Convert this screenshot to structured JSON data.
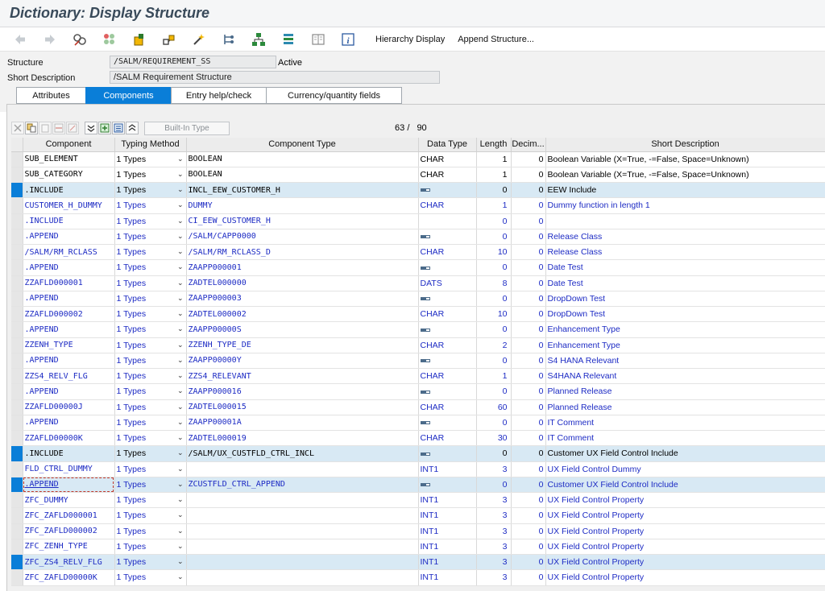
{
  "window": {
    "title": "Dictionary: Display Structure"
  },
  "toolbar": {
    "icons": [
      "back-icon",
      "forward-icon",
      "other-object-icon",
      "display-change-icon",
      "activate-icon",
      "where-used-icon",
      "test-icon",
      "object-list-icon",
      "hierarchy-icon",
      "stack-icon",
      "documentation-icon",
      "info-icon"
    ],
    "hierarchy_display": "Hierarchy Display",
    "append_structure": "Append Structure..."
  },
  "header": {
    "structure_label": "Structure",
    "structure_value": "/SALM/REQUIREMENT_SS",
    "status": "Active",
    "short_desc_label": "Short Description",
    "short_desc_value": "/SALM Requirement Structure"
  },
  "tabs": [
    {
      "label": "Attributes"
    },
    {
      "label": "Components"
    },
    {
      "label": "Entry help/check"
    },
    {
      "label": "Currency/quantity fields"
    }
  ],
  "grid_toolbar": {
    "builtin_type": "Built-In Type"
  },
  "counter": {
    "current": "63",
    "sep": "/",
    "total": "90"
  },
  "columns": [
    "Component",
    "Typing Method",
    "Component Type",
    "Data Type",
    "Length",
    "Decim...",
    "Short Description"
  ],
  "rows": [
    {
      "comp": "SUB_ELEMENT",
      "typing": "1 Types",
      "ctype": "BOOLEAN",
      "dtype": "CHAR",
      "len": "1",
      "dec": "0",
      "desc": "Boolean Variable (X=True, -=False, Space=Unknown)",
      "style": "norm",
      "blue": false,
      "ref": false,
      "mark": false
    },
    {
      "comp": "SUB_CATEGORY",
      "typing": "1 Types",
      "ctype": "BOOLEAN",
      "dtype": "CHAR",
      "len": "1",
      "dec": "0",
      "desc": "Boolean Variable (X=True, -=False, Space=Unknown)",
      "style": "norm",
      "blue": false,
      "ref": false,
      "mark": false
    },
    {
      "comp": ".INCLUDE",
      "typing": "1 Types",
      "ctype": "INCL_EEW_CUSTOMER_H",
      "dtype": "",
      "len": "0",
      "dec": "0",
      "desc": "EEW Include",
      "style": "hl",
      "blue": false,
      "ref": true,
      "mark": true
    },
    {
      "comp": "CUSTOMER_H_DUMMY",
      "typing": "1 Types",
      "ctype": "DUMMY",
      "dtype": "CHAR",
      "len": "1",
      "dec": "0",
      "desc": "Dummy function in length 1",
      "style": "norm",
      "blue": true,
      "ref": false,
      "mark": false
    },
    {
      "comp": ".INCLUDE",
      "typing": "1 Types",
      "ctype": "CI_EEW_CUSTOMER_H",
      "dtype": "",
      "len": "0",
      "dec": "0",
      "desc": "",
      "style": "norm",
      "blue": true,
      "ref": false,
      "mark": false
    },
    {
      "comp": ".APPEND",
      "typing": "1 Types",
      "ctype": "/SALM/CAPP0000",
      "dtype": "",
      "len": "0",
      "dec": "0",
      "desc": "Release Class",
      "style": "norm",
      "blue": true,
      "ref": true,
      "mark": false
    },
    {
      "comp": "/SALM/RM_RCLASS",
      "typing": "1 Types",
      "ctype": "/SALM/RM_RCLASS_D",
      "dtype": "CHAR",
      "len": "10",
      "dec": "0",
      "desc": "Release Class",
      "style": "norm",
      "blue": true,
      "ref": false,
      "mark": false
    },
    {
      "comp": ".APPEND",
      "typing": "1 Types",
      "ctype": "ZAAPP000001",
      "dtype": "",
      "len": "0",
      "dec": "0",
      "desc": "Date Test",
      "style": "norm",
      "blue": true,
      "ref": true,
      "mark": false
    },
    {
      "comp": "ZZAFLD000001",
      "typing": "1 Types",
      "ctype": "ZADTEL000000",
      "dtype": "DATS",
      "len": "8",
      "dec": "0",
      "desc": "Date Test",
      "style": "norm",
      "blue": true,
      "ref": false,
      "mark": false
    },
    {
      "comp": ".APPEND",
      "typing": "1 Types",
      "ctype": "ZAAPP000003",
      "dtype": "",
      "len": "0",
      "dec": "0",
      "desc": "DropDown Test",
      "style": "norm",
      "blue": true,
      "ref": true,
      "mark": false
    },
    {
      "comp": "ZZAFLD000002",
      "typing": "1 Types",
      "ctype": "ZADTEL000002",
      "dtype": "CHAR",
      "len": "10",
      "dec": "0",
      "desc": "DropDown Test",
      "style": "norm",
      "blue": true,
      "ref": false,
      "mark": false
    },
    {
      "comp": ".APPEND",
      "typing": "1 Types",
      "ctype": "ZAAPP00000S",
      "dtype": "",
      "len": "0",
      "dec": "0",
      "desc": "Enhancement Type",
      "style": "norm",
      "blue": true,
      "ref": true,
      "mark": false
    },
    {
      "comp": "ZZENH_TYPE",
      "typing": "1 Types",
      "ctype": "ZZENH_TYPE_DE",
      "dtype": "CHAR",
      "len": "2",
      "dec": "0",
      "desc": "Enhancement Type",
      "style": "norm",
      "blue": true,
      "ref": false,
      "mark": false
    },
    {
      "comp": ".APPEND",
      "typing": "1 Types",
      "ctype": "ZAAPP00000Y",
      "dtype": "",
      "len": "0",
      "dec": "0",
      "desc": "S4 HANA Relevant",
      "style": "norm",
      "blue": true,
      "ref": true,
      "mark": false
    },
    {
      "comp": "ZZS4_RELV_FLG",
      "typing": "1 Types",
      "ctype": "ZZS4_RELEVANT",
      "dtype": "CHAR",
      "len": "1",
      "dec": "0",
      "desc": "S4HANA Relevant",
      "style": "norm",
      "blue": true,
      "ref": false,
      "mark": false
    },
    {
      "comp": ".APPEND",
      "typing": "1 Types",
      "ctype": "ZAAPP000016",
      "dtype": "",
      "len": "0",
      "dec": "0",
      "desc": "Planned Release",
      "style": "norm",
      "blue": true,
      "ref": true,
      "mark": false
    },
    {
      "comp": "ZZAFLD00000J",
      "typing": "1 Types",
      "ctype": "ZADTEL000015",
      "dtype": "CHAR",
      "len": "60",
      "dec": "0",
      "desc": "Planned Release",
      "style": "norm",
      "blue": true,
      "ref": false,
      "mark": false
    },
    {
      "comp": ".APPEND",
      "typing": "1 Types",
      "ctype": "ZAAPP00001A",
      "dtype": "",
      "len": "0",
      "dec": "0",
      "desc": "IT Comment",
      "style": "norm",
      "blue": true,
      "ref": true,
      "mark": false
    },
    {
      "comp": "ZZAFLD00000K",
      "typing": "1 Types",
      "ctype": "ZADTEL000019",
      "dtype": "CHAR",
      "len": "30",
      "dec": "0",
      "desc": "IT Comment",
      "style": "norm",
      "blue": true,
      "ref": false,
      "mark": false
    },
    {
      "comp": ".INCLUDE",
      "typing": "1 Types",
      "ctype": "/SALM/UX_CUSTFLD_CTRL_INCL",
      "dtype": "",
      "len": "0",
      "dec": "0",
      "desc": "Customer UX Field Control Include",
      "style": "hl",
      "blue": false,
      "ref": true,
      "mark": true
    },
    {
      "comp": "FLD_CTRL_DUMMY",
      "typing": "1 Types",
      "ctype": "",
      "dtype": "INT1",
      "len": "3",
      "dec": "0",
      "desc": "UX Field Control Dummy",
      "style": "norm",
      "blue": true,
      "ref": false,
      "mark": false
    },
    {
      "comp": ".APPEND",
      "typing": "1 Types",
      "ctype": "ZCUSTFLD_CTRL_APPEND",
      "dtype": "",
      "len": "0",
      "dec": "0",
      "desc": "Customer UX Field Control Include",
      "style": "hl",
      "blue": true,
      "ref": true,
      "mark": true,
      "focus": true
    },
    {
      "comp": "ZFC_DUMMY",
      "typing": "1 Types",
      "ctype": "",
      "dtype": "INT1",
      "len": "3",
      "dec": "0",
      "desc": "UX Field Control Property",
      "style": "norm",
      "blue": true,
      "ref": false,
      "mark": false
    },
    {
      "comp": "ZFC_ZAFLD000001",
      "typing": "1 Types",
      "ctype": "",
      "dtype": "INT1",
      "len": "3",
      "dec": "0",
      "desc": "UX Field Control Property",
      "style": "norm",
      "blue": true,
      "ref": false,
      "mark": false
    },
    {
      "comp": "ZFC_ZAFLD000002",
      "typing": "1 Types",
      "ctype": "",
      "dtype": "INT1",
      "len": "3",
      "dec": "0",
      "desc": "UX Field Control Property",
      "style": "norm",
      "blue": true,
      "ref": false,
      "mark": false
    },
    {
      "comp": "ZFC_ZENH_TYPE",
      "typing": "1 Types",
      "ctype": "",
      "dtype": "INT1",
      "len": "3",
      "dec": "0",
      "desc": "UX Field Control Property",
      "style": "norm",
      "blue": true,
      "ref": false,
      "mark": false
    },
    {
      "comp": "ZFC_ZS4_RELV_FLG",
      "typing": "1 Types",
      "ctype": "",
      "dtype": "INT1",
      "len": "3",
      "dec": "0",
      "desc": "UX Field Control Property",
      "style": "hl",
      "blue": true,
      "ref": false,
      "mark": true
    },
    {
      "comp": "ZFC_ZAFLD00000K",
      "typing": "1 Types",
      "ctype": "",
      "dtype": "INT1",
      "len": "3",
      "dec": "0",
      "desc": "UX Field Control Property",
      "style": "norm",
      "blue": true,
      "ref": false,
      "mark": false
    }
  ],
  "colors": {
    "accent": "#0a7ed8",
    "link_blue": "#1d2bc4",
    "row_highlight": "#d8e9f4"
  }
}
